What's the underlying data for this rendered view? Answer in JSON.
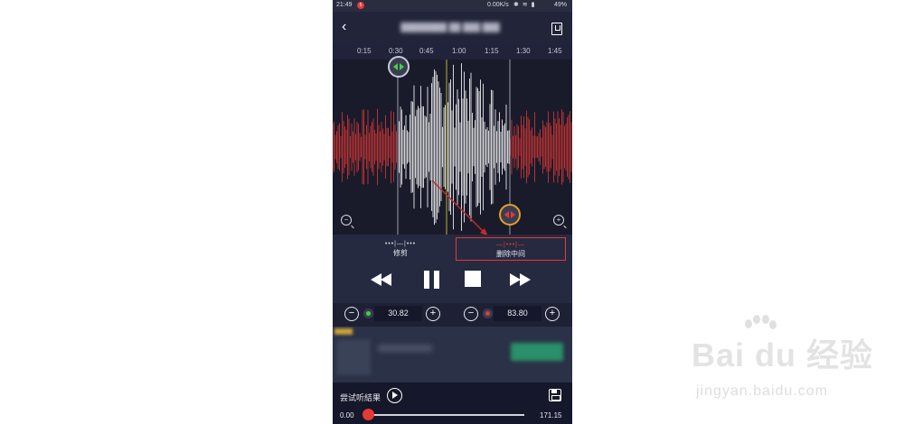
{
  "status_bar": {
    "time": "21:49",
    "notification": "5",
    "net_speed": "0.00K/s",
    "battery": "49%"
  },
  "header": {
    "filename": "████████ ██ ███ ███",
    "back_icon": "chevron-left-icon",
    "save_as_icon": "document-icon"
  },
  "timeline": {
    "ticks": [
      "0:15",
      "0:30",
      "0:45",
      "1:00",
      "1:15",
      "1:30",
      "1:45"
    ]
  },
  "colors": {
    "selected_wave": "#ffffff",
    "removed_wave": "#e53935",
    "accent": "#e53935",
    "start_marker": "#3fd14a",
    "end_marker": "#e2a02a"
  },
  "modes": {
    "trim": {
      "label": "修剪",
      "symbol": "•••|—|•••"
    },
    "delete_middle": {
      "label": "删除中间",
      "symbol": "—|•••|—",
      "active": true
    }
  },
  "steppers": {
    "start": {
      "minus": "−",
      "plus": "+",
      "value": "30.82"
    },
    "end": {
      "minus": "−",
      "plus": "+",
      "value": "83.80"
    }
  },
  "preview": {
    "label": "尝试听結果",
    "current_time": "0.00",
    "total_time": "171.15",
    "progress": 0
  },
  "watermark": {
    "logo": "Bai du 经验",
    "site": "jingyan.baidu.com"
  }
}
